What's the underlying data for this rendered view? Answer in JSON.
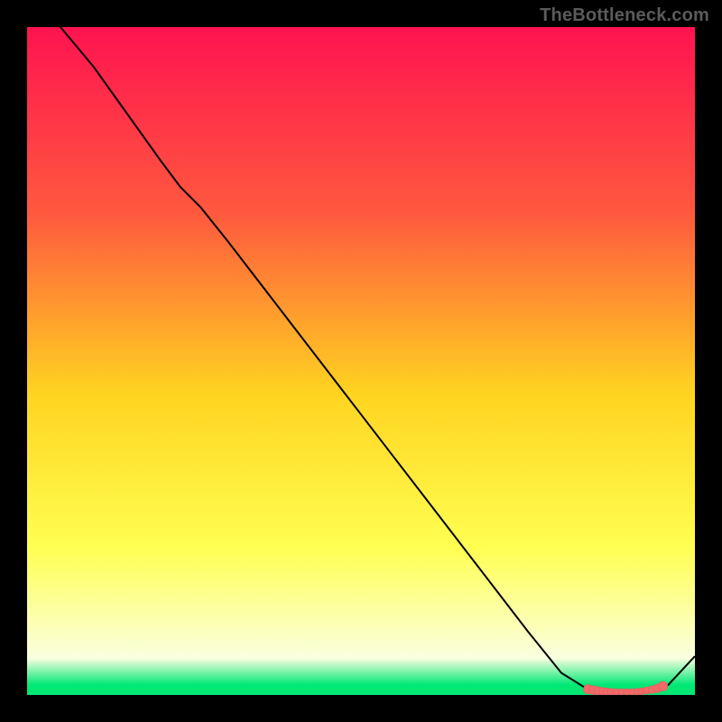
{
  "watermark": "TheBottleneck.com",
  "colors": {
    "frame": "#000000",
    "line": "#000000",
    "marker_fill": "#f06a6a",
    "marker_stroke": "#e85a5a",
    "grad_top": "#ff1350",
    "grad_upper": "#ff593e",
    "grad_mid": "#ffd420",
    "grad_lower": "#ffff52",
    "grad_pale": "#faffe0",
    "grad_green": "#00e874"
  },
  "chart_data": {
    "type": "line",
    "title": "",
    "xlabel": "",
    "ylabel": "",
    "xlim": [
      0,
      100
    ],
    "ylim": [
      0,
      100
    ],
    "series": [
      {
        "name": "curve",
        "x": [
          0,
          5,
          10,
          15,
          20,
          23,
          26,
          30,
          35,
          40,
          45,
          50,
          55,
          60,
          65,
          70,
          75,
          80,
          84,
          86,
          88,
          90,
          92,
          94,
          96,
          100
        ],
        "y": [
          106,
          100,
          94,
          87,
          80,
          76,
          73,
          68,
          61.5,
          55,
          48.5,
          42,
          35.5,
          29,
          22.5,
          16,
          9.5,
          3.3,
          0.8,
          0.5,
          0.5,
          0.5,
          0.6,
          0.8,
          1.5,
          5.8
        ]
      }
    ],
    "markers": {
      "name": "highlight",
      "x": [
        84.0,
        84.8,
        85.5,
        86.2,
        86.8,
        87.4,
        88.2,
        89.0,
        89.8,
        90.6,
        91.4,
        92.0,
        92.8,
        93.6,
        94.4,
        95.2
      ],
      "y": [
        0.85,
        0.72,
        0.62,
        0.55,
        0.5,
        0.46,
        0.44,
        0.44,
        0.44,
        0.46,
        0.48,
        0.55,
        0.66,
        0.8,
        1.0,
        1.3
      ],
      "r": [
        5.2,
        4.9,
        4.6,
        4.3,
        4.1,
        3.9,
        3.8,
        3.7,
        3.7,
        3.7,
        3.8,
        3.9,
        4.1,
        4.4,
        4.8,
        5.3
      ]
    },
    "gradient_stops": [
      {
        "offset": 0.0,
        "key": "grad_top"
      },
      {
        "offset": 0.28,
        "key": "grad_upper"
      },
      {
        "offset": 0.55,
        "key": "grad_mid"
      },
      {
        "offset": 0.78,
        "key": "grad_lower"
      },
      {
        "offset": 0.945,
        "key": "grad_pale"
      },
      {
        "offset": 0.985,
        "key": "grad_green"
      },
      {
        "offset": 1.0,
        "key": "grad_green"
      }
    ]
  }
}
